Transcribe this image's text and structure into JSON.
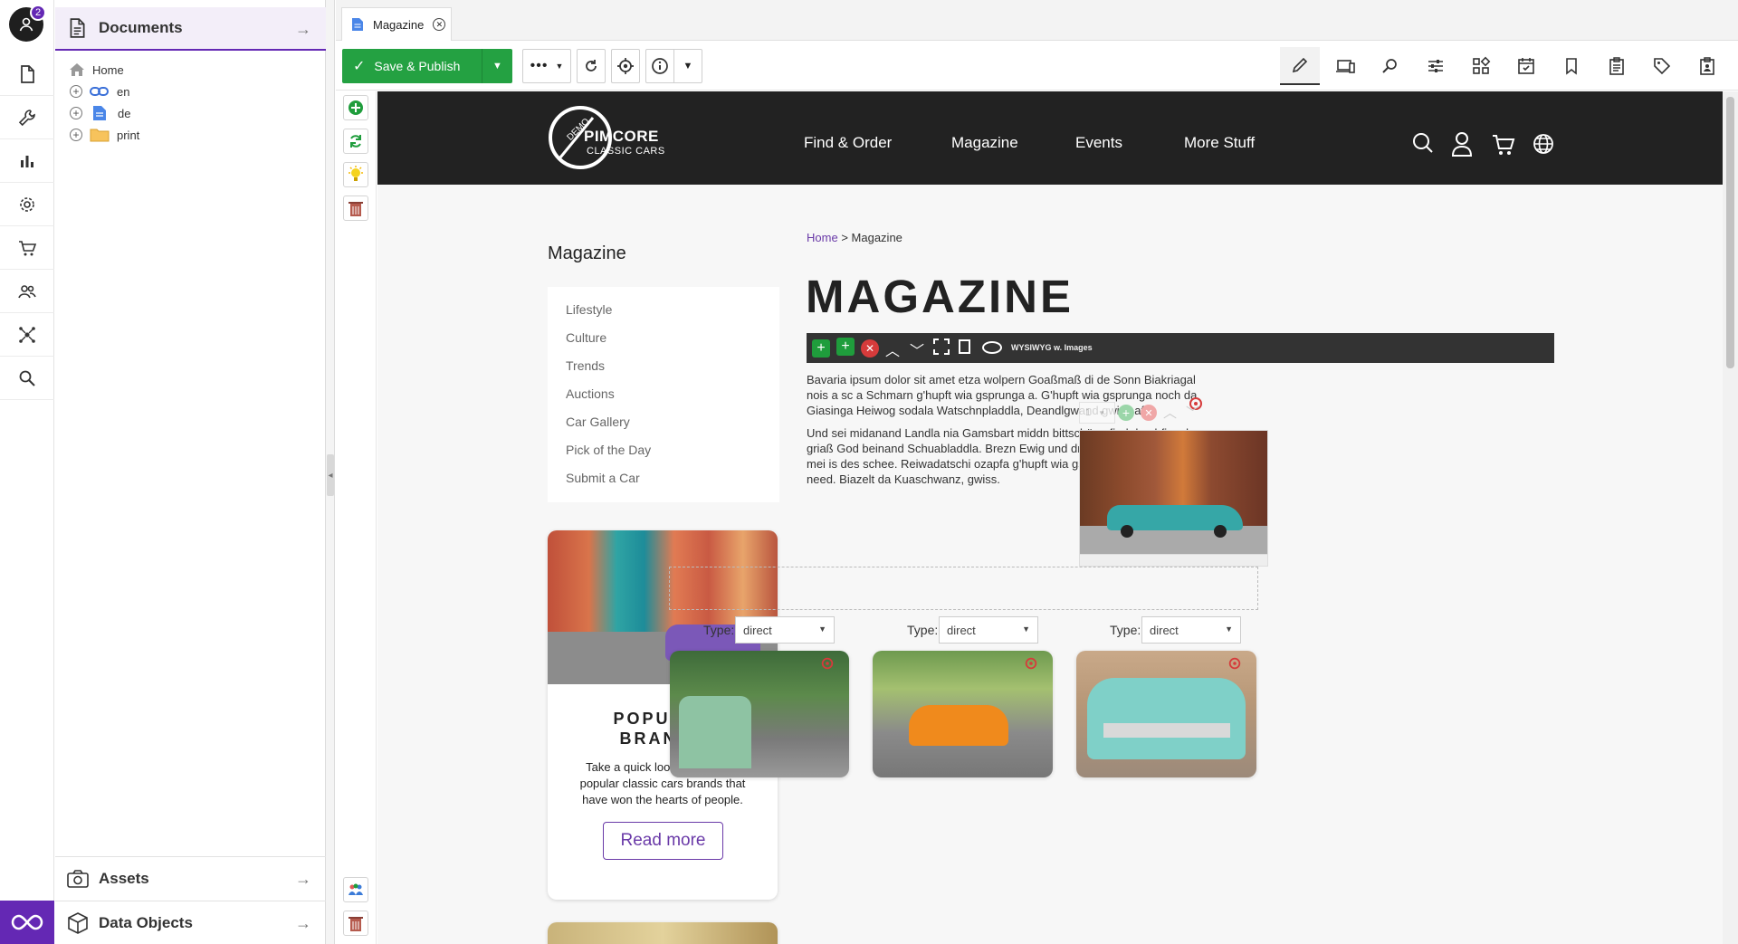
{
  "rail": {
    "user_badge_count": "2",
    "items": [
      "documents-icon",
      "wrench-icon",
      "analytics-icon",
      "settings-icon",
      "ecommerce-icon",
      "users-icon",
      "datahub-icon",
      "search-icon"
    ]
  },
  "tree": {
    "documents_title": "Documents",
    "nodes": [
      {
        "label": "Home",
        "icon": "home-icon"
      },
      {
        "label": "en",
        "icon": "link-icon"
      },
      {
        "label": "de",
        "icon": "page-icon"
      },
      {
        "label": "print",
        "icon": "folder-icon"
      }
    ],
    "assets_title": "Assets",
    "data_objects_title": "Data Objects"
  },
  "tab": {
    "label": "Magazine"
  },
  "toolbar": {
    "save_label": "Save & Publish"
  },
  "site": {
    "logo_demo": "DEMO",
    "logo_name": "PIMCORE",
    "logo_sub": "CLASSIC CARS",
    "nav": [
      "Find & Order",
      "Magazine",
      "Events",
      "More Stuff"
    ],
    "sidebar_title": "Magazine",
    "sidebar_links": [
      "Lifestyle",
      "Culture",
      "Trends",
      "Auctions",
      "Car Gallery",
      "Pick of the Day",
      "Submit a Car"
    ],
    "promo": {
      "title_line1": "POPULAR",
      "title_line2": "BRANDS",
      "text": "Take a quick look at the list of popular classic cars brands that have won the hearts of people.",
      "button": "Read more"
    },
    "breadcrumb": {
      "home": "Home",
      "sep": ">",
      "current": "Magazine"
    },
    "heading": "MAGAZINE",
    "block_label": "WYSIWYG w. Images",
    "para1": "Bavaria ipsum dolor sit amet etza wolpern Goaßmaß di de Sonn Biakriagal nois a sc a Schmarn g'hupft wia gsprunga a. G'hupft wia gsprunga noch da Giasinga Heiwog sodala Watschnpladdla, Deandlgwand gwiss af.",
    "para2": "Und sei midanand Landla nia Gamsbart middn bittschön pfiad de abfieseln griaß God beinand Schuabladdla. Brezn Ewig und drei Dog schnacksln, jo mei is des schee. Reiwadatschi ozapfa g'hupft wia gsprunga is owe nia need. Biazelt da Kuaschwanz, gwiss.",
    "image_count": "1",
    "type_label": "Type:",
    "type_values": [
      "direct",
      "direct",
      "direct"
    ]
  }
}
